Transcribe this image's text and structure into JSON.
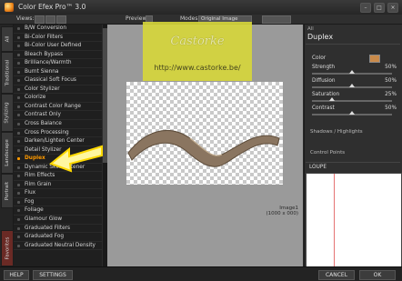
{
  "window": {
    "title": "Color Efex Pro™ 3.0"
  },
  "toolbar": {
    "views_label": "Views:",
    "preview_label": "Preview",
    "modes_label": "Modes:",
    "mode_value": "Original Image"
  },
  "tabs": [
    "All",
    "Traditional",
    "Stylizing",
    "Landscape",
    "Portrait",
    "Favorites"
  ],
  "filters": {
    "items": [
      "B/W Conversion",
      "Bi-Color Filters",
      "Bi-Color User Defined",
      "Bleach Bypass",
      "Brilliance/Warmth",
      "Burnt Sienna",
      "Classical Soft Focus",
      "Color Stylizer",
      "Colorize",
      "Contrast Color Range",
      "Contrast Only",
      "Cross Balance",
      "Cross Processing",
      "Darken/Lighten Center",
      "Detail Stylizer",
      "Duplex",
      "Dynamic Skin Softener",
      "Film Effects",
      "Film Grain",
      "Flux",
      "Fog",
      "Foliage",
      "Glamour Glow",
      "Graduated Filters",
      "Graduated Fog",
      "Graduated Neutral Density"
    ],
    "selected": "Duplex"
  },
  "watermark": {
    "logo": "Castorke",
    "url": "http://www.castorke.be/"
  },
  "image_info": {
    "name": "Image1",
    "size": "(1000 x 000)"
  },
  "panel": {
    "category": "All",
    "filter_name": "Duplex",
    "color_label": "Color",
    "color_swatch": "#c98a4a",
    "sliders": [
      {
        "label": "Strength",
        "value": "50%",
        "level": 0.5
      },
      {
        "label": "Diffusion",
        "value": "50%",
        "level": 0.5
      },
      {
        "label": "Saturation",
        "value": "25%",
        "level": 0.25
      },
      {
        "label": "Contrast",
        "value": "50%",
        "level": 0.5
      }
    ],
    "sections": [
      "Shadows / Highlights",
      "Control Points"
    ],
    "loupe_label": "LOUPE"
  },
  "footer": {
    "help": "HELP",
    "settings": "SETTINGS",
    "cancel": "CANCEL",
    "ok": "OK"
  },
  "colors": {
    "selected": "#ff9a00",
    "arrow": "#ffd800",
    "favorites_tab": "#6a2a25"
  }
}
